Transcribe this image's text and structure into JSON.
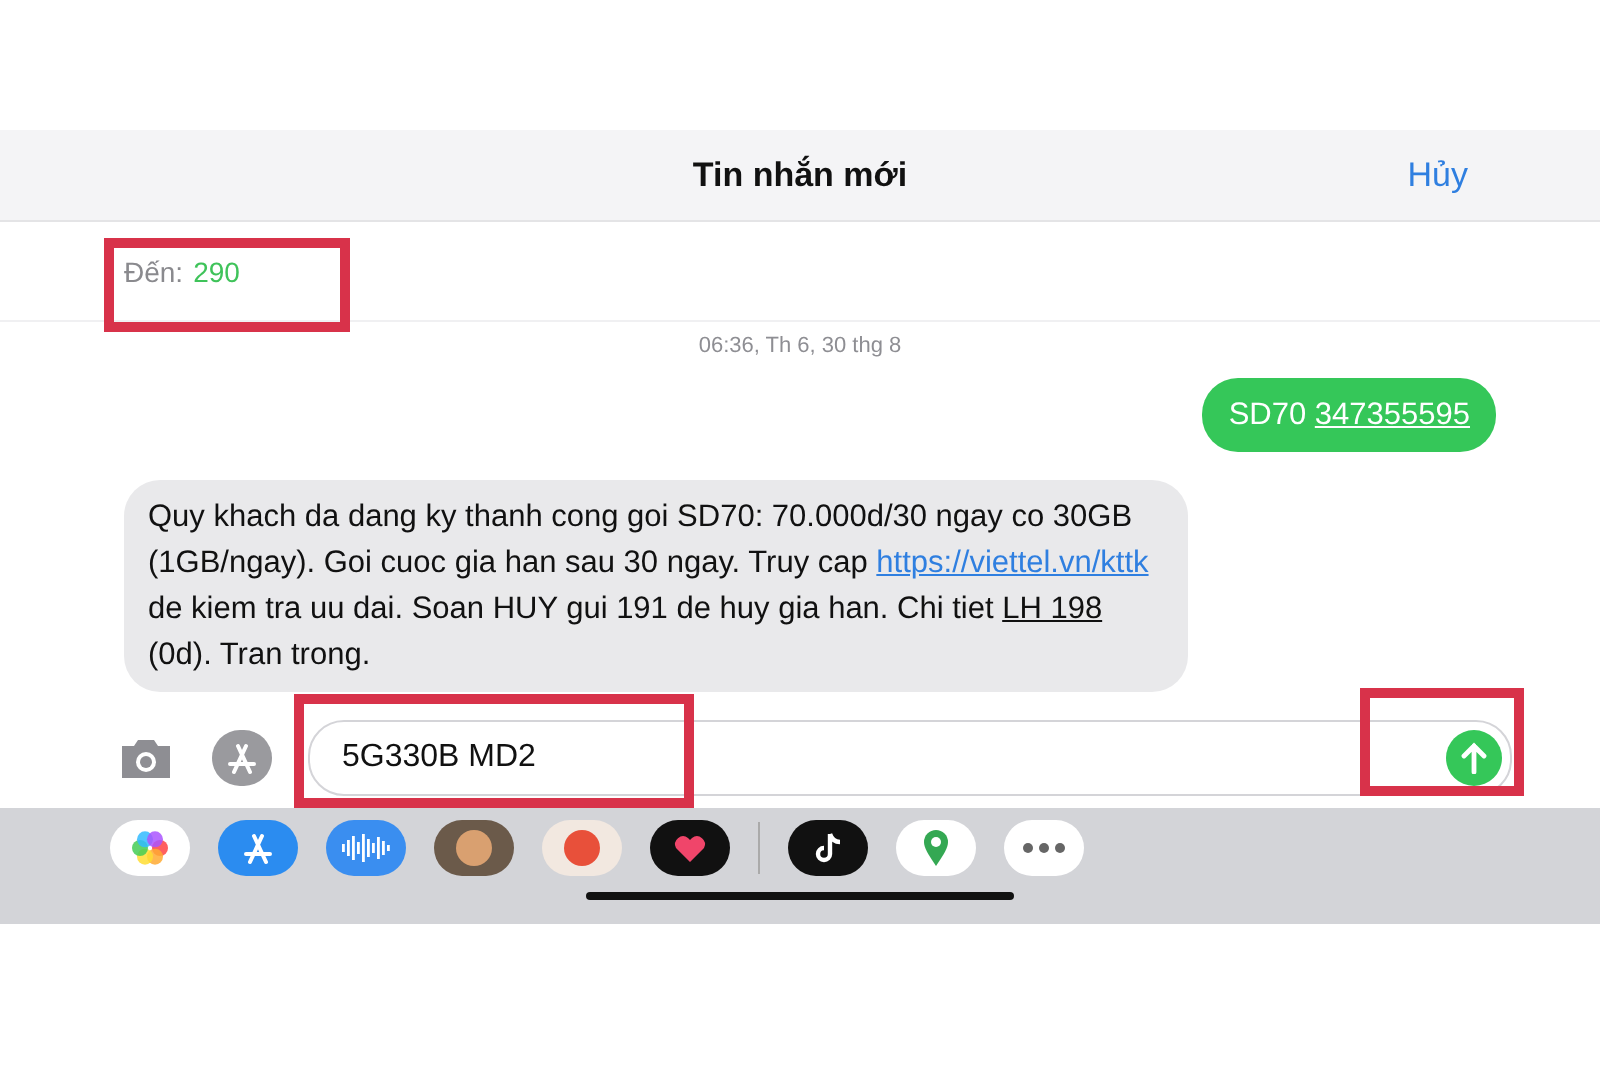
{
  "header": {
    "title": "Tin nhắn mới",
    "cancel": "Hủy"
  },
  "recipient": {
    "label": "Đến:",
    "value": "290",
    "highlighted": true
  },
  "timestamp": "06:36, Th 6, 30 thg 8",
  "messages": [
    {
      "kind": "sent",
      "parts": [
        {
          "kind": "text",
          "text": "SD70 "
        },
        {
          "kind": "underline",
          "text": "347355595"
        }
      ]
    },
    {
      "kind": "received",
      "parts": [
        {
          "kind": "text",
          "text": "Quy khach da dang ky thanh cong goi SD70: 70.000d/30 ngay co 30GB (1GB/ngay). Goi cuoc gia han sau 30 ngay. Truy cap "
        },
        {
          "kind": "link",
          "text": "https://viettel.vn/kttk"
        },
        {
          "kind": "text",
          "text": " de kiem tra uu dai. Soan HUY gui 191 de huy gia han. Chi tiet "
        },
        {
          "kind": "underline",
          "text": "LH 198"
        },
        {
          "kind": "text",
          "text": " (0d). Tran trong."
        }
      ]
    }
  ],
  "composer": {
    "value": "5G330B MD2",
    "highlighted": true,
    "send_highlighted": true
  }
}
